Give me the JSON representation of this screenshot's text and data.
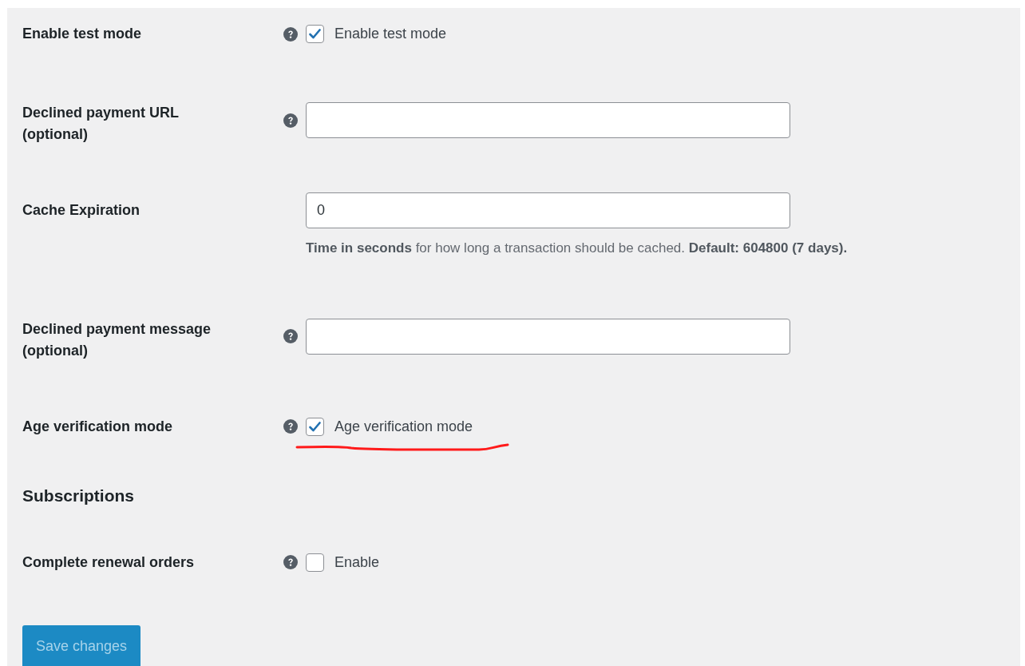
{
  "fields": [
    {
      "kind": "checkbox",
      "label": "Enable test mode",
      "help": true,
      "checked": true,
      "option": "Enable test mode",
      "underlined": false
    },
    {
      "kind": "text",
      "label": "Declined payment URL (optional)",
      "help": true
    },
    {
      "kind": "text",
      "label": "Cache Expiration",
      "help": false,
      "value": "0",
      "description": "**Time in seconds** for how long a transaction should be cached. **Default: 604800 (7 days).**"
    },
    {
      "kind": "text",
      "label": "Declined payment message (optional)",
      "help": true
    },
    {
      "kind": "checkbox",
      "label": "Age verification mode",
      "help": true,
      "checked": true,
      "option": "Age verification mode",
      "underlined": true
    },
    {
      "kind": "heading",
      "label": "Subscriptions"
    },
    {
      "kind": "checkbox",
      "label": "Complete renewal orders",
      "help": true,
      "checked": false,
      "option": "Enable",
      "underlined": false
    }
  ],
  "save_button": {
    "label": "Save changes",
    "disabled": true
  }
}
